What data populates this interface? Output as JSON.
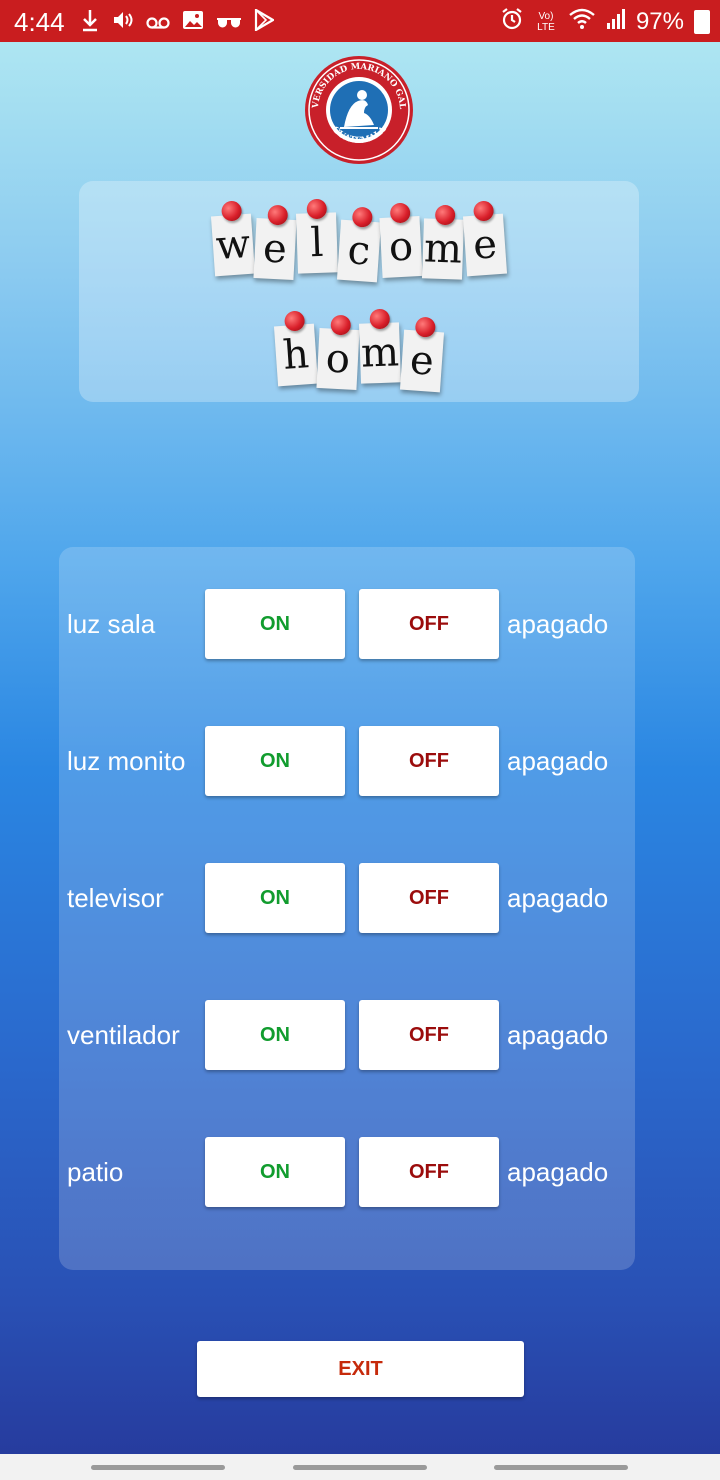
{
  "status_bar": {
    "time": "4:44",
    "battery": "97%",
    "network_label": "Vo) LTE",
    "left_icons": [
      "download-icon",
      "volume-icon",
      "voicemail-icon",
      "image-icon",
      "glasses-icon",
      "play-store-icon"
    ],
    "right_icons": [
      "alarm-icon",
      "volte-icon",
      "wifi-icon",
      "signal-icon",
      "battery-icon"
    ],
    "color": "#c91d1f"
  },
  "logo": {
    "ring_top_text": "UNIVERSIDAD MARIANO GALVEZ",
    "ring_bottom_text": "GUATEMALA"
  },
  "welcome": {
    "line1": [
      "w",
      "e",
      "l",
      "c",
      "o",
      "m",
      "e"
    ],
    "line2": [
      "h",
      "o",
      "m",
      "e"
    ]
  },
  "devices": [
    {
      "label": "luz sala",
      "on_label": "ON",
      "off_label": "OFF",
      "status": "apagado"
    },
    {
      "label": "luz monito",
      "on_label": "ON",
      "off_label": "OFF",
      "status": "apagado"
    },
    {
      "label": "televisor",
      "on_label": "ON",
      "off_label": "OFF",
      "status": "apagado"
    },
    {
      "label": "ventilador",
      "on_label": "ON",
      "off_label": "OFF",
      "status": "apagado"
    },
    {
      "label": "patio",
      "on_label": "ON",
      "off_label": "OFF",
      "status": "apagado"
    }
  ],
  "exit_label": "EXIT",
  "colors": {
    "on": "#119c2e",
    "off": "#9b0c0c",
    "exit": "#c62a0b"
  }
}
